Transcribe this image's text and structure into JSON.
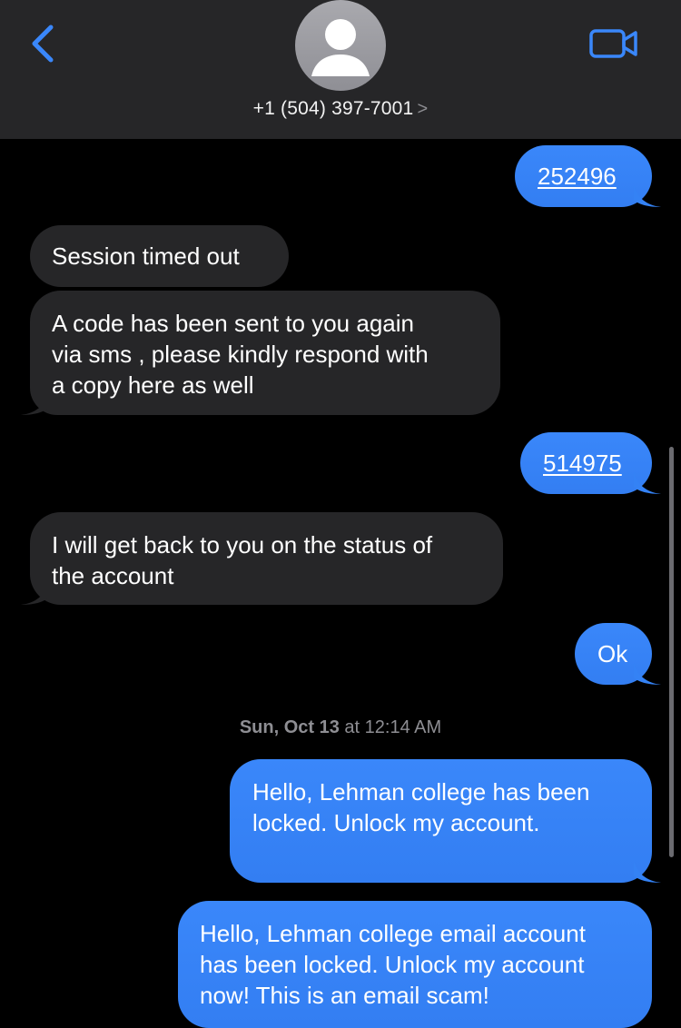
{
  "header": {
    "back_icon": "chevron-left-icon",
    "avatar_icon": "person-silhouette-icon",
    "contact_number": "+1 (504) 397-7001",
    "contact_chevron": ">",
    "video_icon": "video-camera-icon"
  },
  "colors": {
    "sent_bubble": "#3a87fa",
    "received_bubble": "#262628",
    "header_bg": "#262628",
    "accent": "#3a87fa",
    "timestamp": "#8e8e93"
  },
  "messages": [
    {
      "direction": "sent",
      "text": "252496",
      "link": true
    },
    {
      "direction": "received",
      "text": "Session timed out"
    },
    {
      "direction": "received",
      "lines": [
        "A code has been sent to you again",
        "via sms , please kindly respond with",
        "a copy here as well"
      ]
    },
    {
      "direction": "sent",
      "text": "514975",
      "link": true
    },
    {
      "direction": "received",
      "lines": [
        "I will get back to you on the status of",
        "the account"
      ]
    },
    {
      "direction": "sent",
      "text": "Ok"
    }
  ],
  "timestamp": {
    "day": "Sun, Oct 13",
    "at": " at 12:14 AM"
  },
  "later_messages": [
    {
      "direction": "sent",
      "lines": [
        "Hello, Lehman college has been",
        "locked. Unlock my account."
      ]
    },
    {
      "direction": "sent",
      "lines": [
        "Hello, Lehman college email account",
        "has been locked. Unlock my account",
        "now! This is an email scam!"
      ]
    }
  ]
}
